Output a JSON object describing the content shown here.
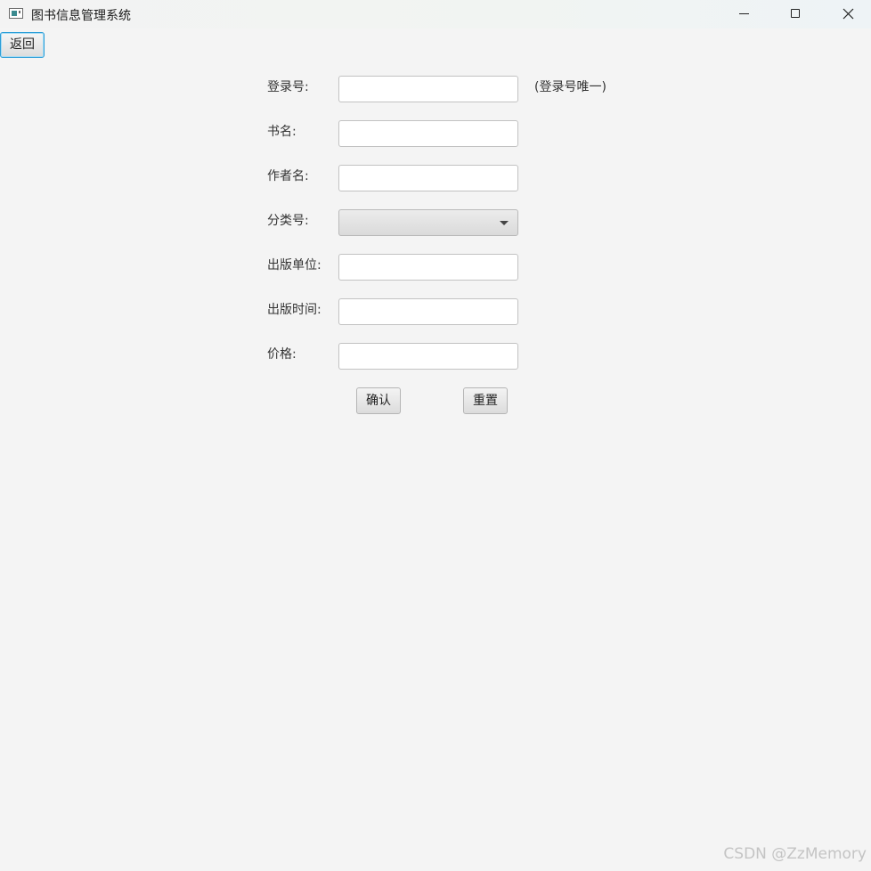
{
  "window": {
    "title": "图书信息管理系统",
    "icons": {
      "app": "app-window-icon",
      "minimize": "minimize-icon",
      "maximize": "maximize-icon",
      "close": "close-icon"
    }
  },
  "toolbar": {
    "back_label": "返回"
  },
  "form": {
    "fields": [
      {
        "label": "登录号:",
        "value": ""
      },
      {
        "label": "书名:",
        "value": ""
      },
      {
        "label": "作者名:",
        "value": ""
      },
      {
        "label": "分类号:",
        "value": ""
      },
      {
        "label": "出版单位:",
        "value": ""
      },
      {
        "label": "出版时间:",
        "value": ""
      },
      {
        "label": "价格:",
        "value": ""
      }
    ],
    "login_hint": "(登录号唯一)",
    "confirm_label": "确认",
    "reset_label": "重置"
  },
  "watermark": "CSDN @ZzMemory",
  "colors": {
    "background": "#f4f4f4",
    "focus_border": "#2c9ed8"
  }
}
